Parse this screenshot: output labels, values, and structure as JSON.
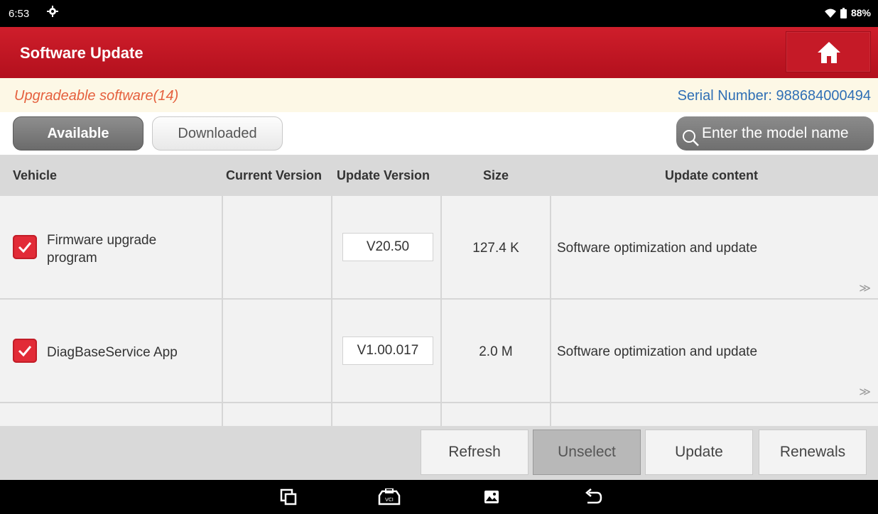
{
  "status_bar": {
    "time": "6:53",
    "battery": "88%",
    "icons": [
      "settings-gear-icon",
      "wifi-icon",
      "battery-icon"
    ]
  },
  "header": {
    "title": "Software Update",
    "home_icon": "home-icon",
    "accent_color": "#c8141f"
  },
  "info": {
    "upgradeable": "Upgradeable software(14)",
    "serial_label": "Serial Number:",
    "serial_value": "988684000494"
  },
  "tabs": [
    {
      "label": "Available",
      "selected": true
    },
    {
      "label": "Downloaded",
      "selected": false
    }
  ],
  "search": {
    "placeholder": "Enter the model name"
  },
  "table": {
    "columns": [
      "Vehicle",
      "Current Version",
      "Update Version",
      "Size",
      "Update content"
    ],
    "rows": [
      {
        "checked": true,
        "vehicle": "Firmware upgrade program",
        "current_version": "",
        "update_version": "V20.50",
        "size": "127.4 K",
        "content": "Software optimization and update",
        "more": "≫"
      },
      {
        "checked": true,
        "vehicle": "DiagBaseService App",
        "current_version": "",
        "update_version": "V1.00.017",
        "size": "2.0 M",
        "content": "Software optimization and update",
        "more": "≫"
      }
    ]
  },
  "actions": {
    "refresh": "Refresh",
    "unselect": "Unselect",
    "update": "Update",
    "renewals": "Renewals"
  },
  "nav_bar": {
    "icons": [
      "recent-apps-icon",
      "vci-icon",
      "gallery-icon",
      "back-icon"
    ]
  }
}
